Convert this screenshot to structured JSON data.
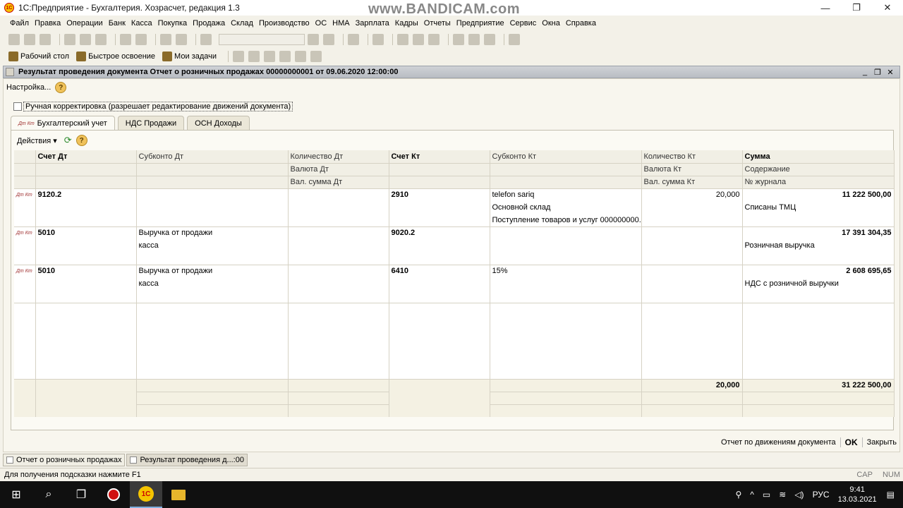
{
  "window": {
    "title": "1С:Предприятие - Бухгалтерия. Хозрасчет, редакция 1.3",
    "watermark": "www.BANDICAM.com",
    "minimize": "—",
    "restore": "❐",
    "close": "✕"
  },
  "menu": [
    "Файл",
    "Правка",
    "Операции",
    "Банк",
    "Касса",
    "Покупка",
    "Продажа",
    "Склад",
    "Производство",
    "ОС",
    "НМА",
    "Зарплата",
    "Кадры",
    "Отчеты",
    "Предприятие",
    "Сервис",
    "Окна",
    "Справка"
  ],
  "quickbar": {
    "desktop": "Рабочий стол",
    "quickstart": "Быстрое освоение",
    "tasks": "Мои задачи"
  },
  "document": {
    "title": "Результат проведения документа Отчет о розничных продажах 00000000001 от 09.06.2020 12:00:00"
  },
  "form": {
    "settings": "Настройка...",
    "help": "?",
    "manual_label": "Ручная корректировка (разрешает редактирование движений документа)",
    "tabs": [
      "Бухгалтерский учет",
      "НДС Продажи",
      "ОСН Доходы"
    ],
    "dtkt": "Дт Кт",
    "actions": "Действия ▾",
    "refresh": "⟳"
  },
  "grid": {
    "header_row1": [
      "Счет Дт",
      "Субконто Дт",
      "Количество Дт",
      "Счет Кт",
      "Субконто Кт",
      "Количество Кт",
      "Сумма"
    ],
    "header_row2": [
      "",
      "",
      "Валюта Дт",
      "",
      "",
      "Валюта Кт",
      "Содержание"
    ],
    "header_row3": [
      "",
      "",
      "Вал. сумма Дт",
      "",
      "",
      "Вал. сумма Кт",
      "№ журнала"
    ],
    "records": [
      {
        "dt": "9120.2",
        "subdt": [
          "",
          "",
          ""
        ],
        "qtydt": [
          "",
          "",
          ""
        ],
        "kt": "2910",
        "subkt": [
          "telefon sariq",
          "Основной склад",
          "Поступление товаров и услуг 000000000..."
        ],
        "qtykt": [
          "20,000",
          "",
          ""
        ],
        "sum": "11 222 500,00",
        "content": "Списаны ТМЦ",
        "journal": ""
      },
      {
        "dt": "5010",
        "subdt": [
          "Выручка от продажи",
          "касса",
          ""
        ],
        "qtydt": [
          "",
          "",
          ""
        ],
        "kt": "9020.2",
        "subkt": [
          "",
          "",
          ""
        ],
        "qtykt": [
          "",
          "",
          ""
        ],
        "sum": "17 391 304,35",
        "content": "Розничная выручка",
        "journal": ""
      },
      {
        "dt": "5010",
        "subdt": [
          "Выручка от продажи",
          "касса",
          ""
        ],
        "qtydt": [
          "",
          "",
          ""
        ],
        "kt": "6410",
        "subkt": [
          "15%",
          "",
          ""
        ],
        "qtykt": [
          "",
          "",
          ""
        ],
        "sum": "2 608 695,65",
        "content": "НДС с розничной выручки",
        "journal": ""
      }
    ],
    "totals": {
      "qtykt": "20,000",
      "sum": "31 222 500,00"
    }
  },
  "bottom": {
    "report": "Отчет по движениям документа",
    "ok": "OK",
    "close": "Закрыть"
  },
  "taskrow": [
    "Отчет о розничных продажах",
    "Результат проведения д...:00"
  ],
  "status": {
    "hint": "Для получения подсказки нажмите F1",
    "cap": "CAP",
    "num": "NUM"
  },
  "taskbar": {
    "lang": "РУС",
    "time": "9:41",
    "date": "13.03.2021",
    "app_1c": "1С"
  }
}
